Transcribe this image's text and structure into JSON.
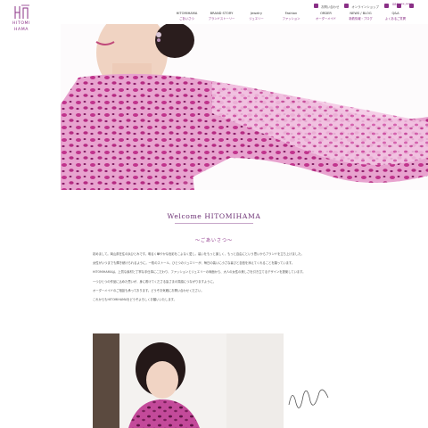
{
  "brand": {
    "name_line1": "HITOMI",
    "name_line2": "HAMA"
  },
  "nav": [
    {
      "en": "HITOMIHAMA",
      "jp": "ごあいさつ"
    },
    {
      "en": "BRAND STORY",
      "jp": "ブランドストーリー"
    },
    {
      "en": "Jewelry",
      "jp": "ジュエリー"
    },
    {
      "en": "Fashion",
      "jp": "ファッション"
    },
    {
      "en": "ORDER",
      "jp": "オーダーメイド"
    },
    {
      "en": "NEWS / BLOG",
      "jp": "新着情報・ブログ"
    },
    {
      "en": "Q&A",
      "jp": "よくあるご質問"
    }
  ],
  "utility": {
    "contact": "お問い合わせ",
    "shop": "オンラインショップ",
    "tel": "086-***-**** "
  },
  "welcome": {
    "title": "Welcome HITOMIHAMA",
    "subtitle": "～ごあいさつ～",
    "paragraphs": [
      "初めまして。岡山県在住の浜ひとみです。明るく華やかな色彩をこよなく愛し、装いをもっと楽しく、もっと自由にという思いからブランドを立ち上げました。",
      "女性がいつまでも輝き続けられるように。一枚のストール、ひとつのジュエリーが、毎日の装いに小さな喜びと自信を添えてくれることを願っています。",
      "HITOMIHAMAは、上質な素材と丁寧な手仕事にこだわり、ファッションとジュエリーの両面から、大人の女性の美しさを引き立てるデザインを提案しています。",
      "一つひとつの作品に込めた思いが、身に着けてくださる皆さまの笑顔につながりますように。",
      "オーダーメイドのご相談も承っております。どうぞお気軽にお問い合わせください。",
      "これからもHITOMIHAMAをどうぞよろしくお願いいたします。"
    ]
  },
  "signature": "Hitomi Hama",
  "colors": {
    "accent": "#8a2f86",
    "leopard_pink": "#d64fa6"
  }
}
